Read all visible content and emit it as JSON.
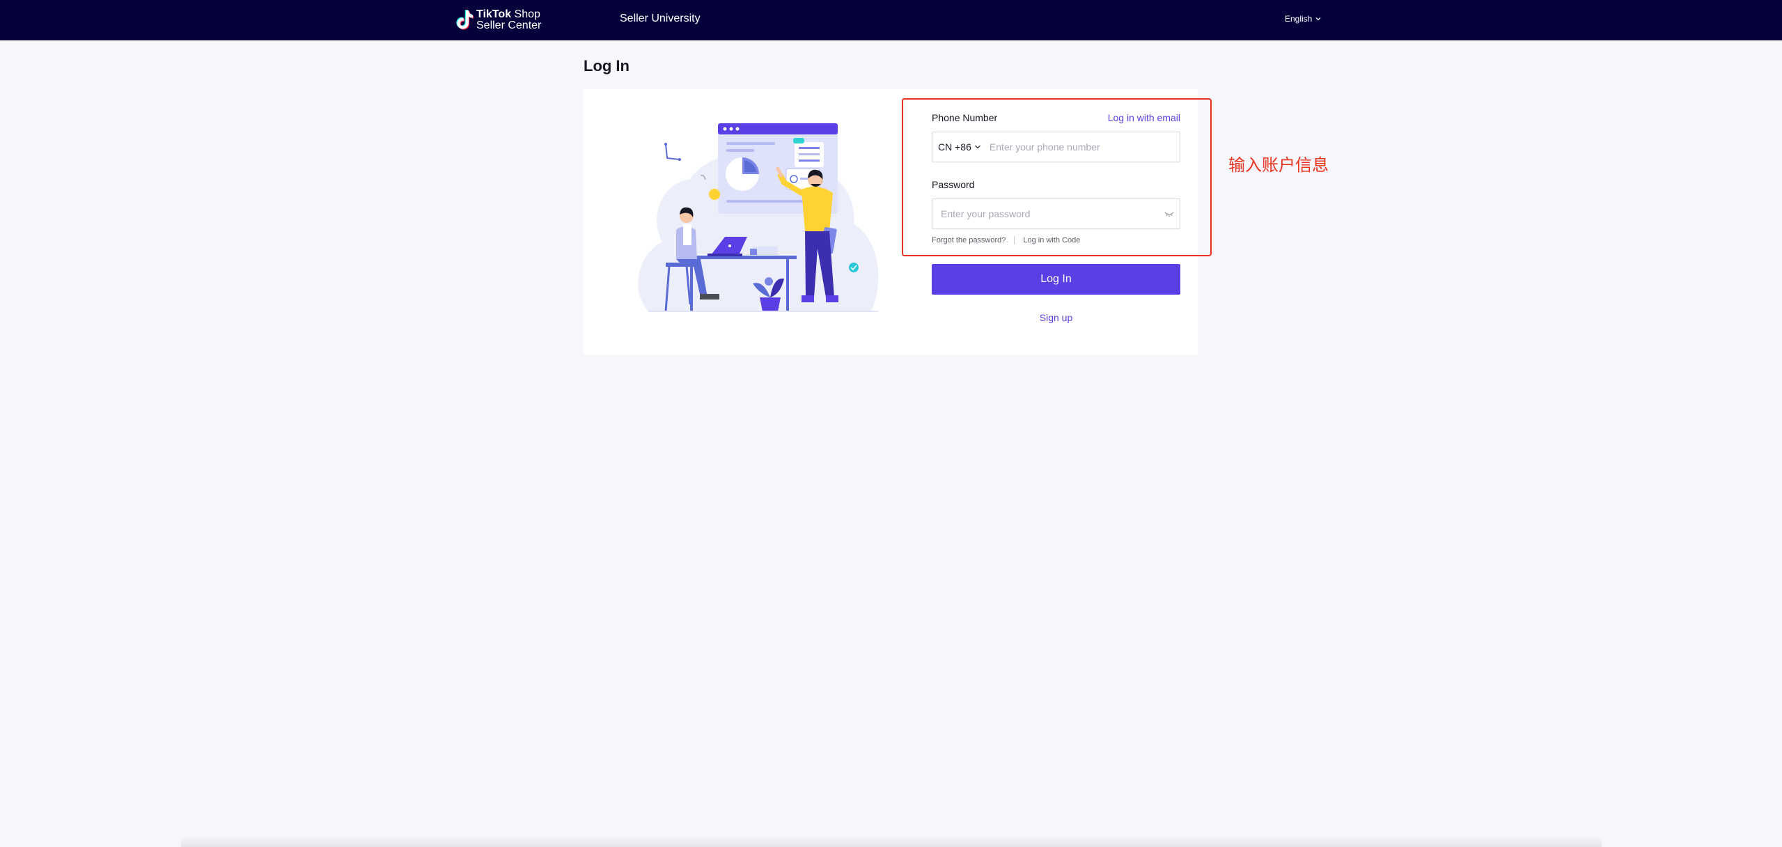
{
  "header": {
    "logo_line1_bold": "TikTok",
    "logo_line1_rest": " Shop",
    "logo_line2": "Seller Center",
    "nav_university": "Seller University",
    "language": "English",
    "bg_color": "#04003a"
  },
  "page": {
    "title": "Log In"
  },
  "form": {
    "phone_label": "Phone Number",
    "email_link": "Log in with email",
    "country_code": "CN +86",
    "phone_placeholder": "Enter your phone number",
    "password_label": "Password",
    "password_placeholder": "Enter your password",
    "forgot_link": "Forgot the password?",
    "code_link": "Log in with Code",
    "login_button": "Log In",
    "signup_link": "Sign up",
    "accent_color": "#5b3fe4"
  },
  "annotation": {
    "text": "输入账户信息",
    "color": "#e8321e"
  },
  "icons": {
    "logo": "tiktok-logo-icon",
    "lang_chevron": "chevron-down-icon",
    "cc_chevron": "chevron-down-icon",
    "eye": "eye-closed-icon"
  }
}
